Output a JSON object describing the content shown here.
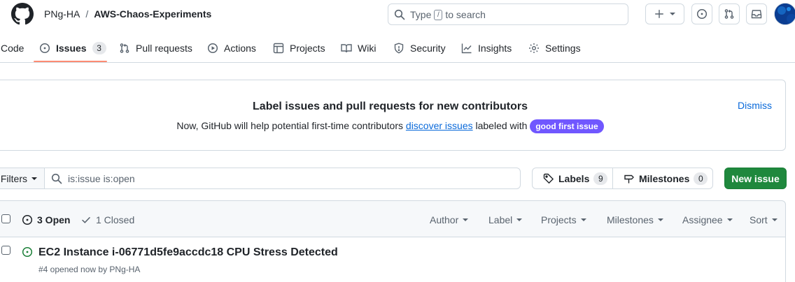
{
  "header": {
    "owner": "PNg-HA",
    "separator": "/",
    "repo": "AWS-Chaos-Experiments",
    "search_prefix": "Type",
    "search_key": "/",
    "search_suffix": "to search",
    "plus_icon": "plus-icon",
    "avatar_color": "#0b3d91"
  },
  "nav": {
    "code": "Code",
    "issues": "Issues",
    "issues_count": "3",
    "pulls": "Pull requests",
    "actions": "Actions",
    "projects": "Projects",
    "wiki": "Wiki",
    "security": "Security",
    "insights": "Insights",
    "settings": "Settings"
  },
  "banner": {
    "title": "Label issues and pull requests for new contributors",
    "text_before": "Now, GitHub will help potential first-time contributors",
    "link": "discover issues",
    "text_after": "labeled with",
    "label": "good first issue",
    "label_color": "#7057ff",
    "dismiss": "Dismiss"
  },
  "filter": {
    "button": "Filters",
    "query": "is:issue is:open",
    "labels": "Labels",
    "labels_count": "9",
    "milestones": "Milestones",
    "milestones_count": "0",
    "new_issue": "New issue",
    "accent": "#1f883d"
  },
  "list": {
    "open": "3 Open",
    "closed": "1 Closed",
    "filters": [
      "Author",
      "Label",
      "Projects",
      "Milestones",
      "Assignee",
      "Sort"
    ],
    "issues": [
      {
        "title": "EC2 Instance i-06771d5fe9accdc18 CPU Stress Detected",
        "meta": "#4 opened now by PNg-HA",
        "state_color": "#1a7f37"
      }
    ]
  }
}
